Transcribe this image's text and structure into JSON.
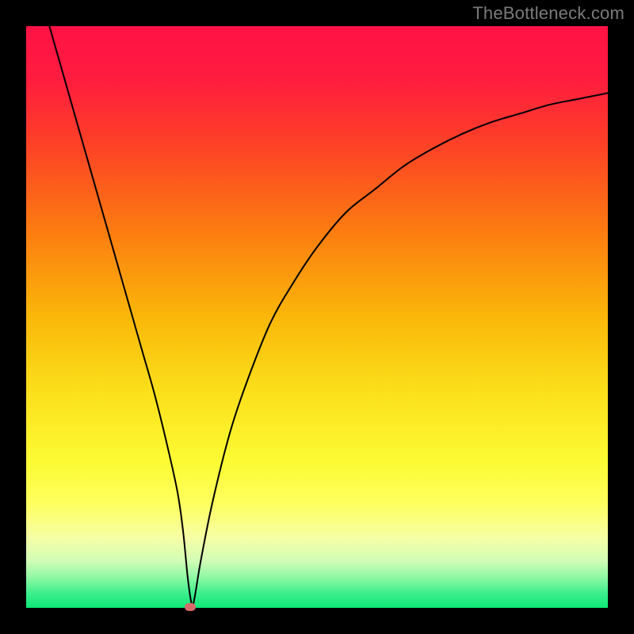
{
  "watermark": "TheBottleneck.com",
  "chart_data": {
    "type": "line",
    "title": "",
    "xlabel": "",
    "ylabel": "",
    "xlim": [
      0,
      100
    ],
    "ylim": [
      0,
      100
    ],
    "series": [
      {
        "name": "bottleneck-curve",
        "x": [
          4,
          6,
          8,
          10,
          12,
          14,
          16,
          18,
          20,
          22,
          24,
          26,
          27,
          27.8,
          28.5,
          29,
          30,
          32,
          35,
          38,
          42,
          46,
          50,
          55,
          60,
          65,
          70,
          75,
          80,
          85,
          90,
          95,
          100
        ],
        "values": [
          100,
          93,
          86,
          79,
          72,
          65,
          58,
          51,
          44,
          37,
          29,
          20,
          13,
          5,
          0.5,
          2,
          8,
          18,
          30,
          39,
          49,
          56,
          62,
          68,
          72,
          76,
          79,
          81.5,
          83.5,
          85,
          86.5,
          87.5,
          88.5
        ]
      }
    ],
    "marker": {
      "x": 28.2,
      "y": 0.2
    },
    "background_gradient": {
      "stops": [
        {
          "offset": 0.0,
          "color": "#ff1244"
        },
        {
          "offset": 0.09,
          "color": "#ff1c3f"
        },
        {
          "offset": 0.2,
          "color": "#fd4027"
        },
        {
          "offset": 0.35,
          "color": "#fc7b11"
        },
        {
          "offset": 0.5,
          "color": "#fab709"
        },
        {
          "offset": 0.63,
          "color": "#fbe01b"
        },
        {
          "offset": 0.75,
          "color": "#fcfb34"
        },
        {
          "offset": 0.82,
          "color": "#feff5e"
        },
        {
          "offset": 0.88,
          "color": "#f6ffa6"
        },
        {
          "offset": 0.92,
          "color": "#d0fdb6"
        },
        {
          "offset": 0.95,
          "color": "#88f7a2"
        },
        {
          "offset": 0.975,
          "color": "#3cee8c"
        },
        {
          "offset": 1.0,
          "color": "#0de877"
        }
      ]
    }
  }
}
